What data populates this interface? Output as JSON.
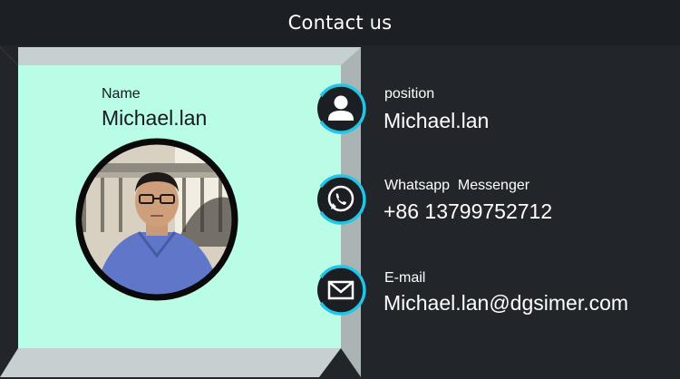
{
  "header": {
    "title": "Contact us"
  },
  "card": {
    "name_label": "Name",
    "name_value": "Michael.lan"
  },
  "contacts": [
    {
      "icon": "person-icon",
      "label": "position",
      "value": "Michael.lan"
    },
    {
      "icon": "whatsapp-icon",
      "label": "Whatsapp  Messenger",
      "value": "+86 13799752712"
    },
    {
      "icon": "mail-icon",
      "label": "E-mail",
      "value": "Michael.lan@dgsimer.com"
    }
  ],
  "colors": {
    "background": "#22262b",
    "header": "#1c1f24",
    "card_fill": "#b9fde6",
    "card_border": "#c7d0d0",
    "icon_ring": "#21c6e6",
    "icon_fill": "#1b1f24"
  }
}
